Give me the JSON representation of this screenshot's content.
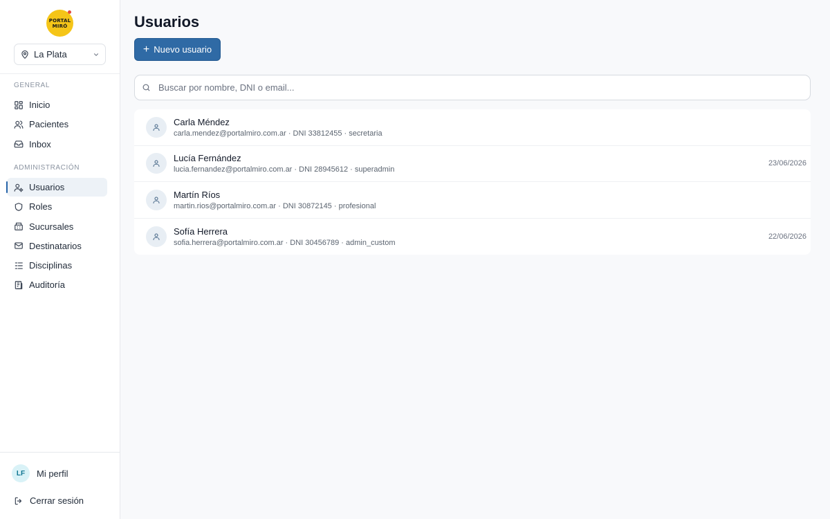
{
  "brand": {
    "logo_line1": "PORTAL",
    "logo_line2": "MIRÓ"
  },
  "branch": {
    "selected": "La Plata"
  },
  "nav": {
    "general_label": "GENERAL",
    "general_items": [
      {
        "label": "Inicio",
        "icon": "grid-icon"
      },
      {
        "label": "Pacientes",
        "icon": "users-icon"
      },
      {
        "label": "Inbox",
        "icon": "inbox-icon"
      }
    ],
    "admin_label": "ADMINISTRACIÓN",
    "admin_items": [
      {
        "label": "Usuarios",
        "icon": "user-gear-icon",
        "active": true
      },
      {
        "label": "Roles",
        "icon": "shield-icon"
      },
      {
        "label": "Sucursales",
        "icon": "building-icon"
      },
      {
        "label": "Destinatarios",
        "icon": "mail-icon"
      },
      {
        "label": "Disciplinas",
        "icon": "list-icon"
      },
      {
        "label": "Auditoría",
        "icon": "audit-icon"
      }
    ]
  },
  "footer": {
    "avatar_initials": "LF",
    "profile_label": "Mi perfil",
    "logout_label": "Cerrar sesión"
  },
  "main": {
    "title": "Usuarios",
    "new_button": "Nuevo usuario",
    "search_placeholder": "Buscar por nombre, DNI o email...",
    "users": [
      {
        "name": "Carla Méndez",
        "meta": "carla.mendez@portalmiro.com.ar · DNI 33812455 · secretaria",
        "date": ""
      },
      {
        "name": "Lucía Fernández",
        "meta": "lucia.fernandez@portalmiro.com.ar · DNI 28945612 · superadmin",
        "date": "23/06/2026"
      },
      {
        "name": "Martín Ríos",
        "meta": "martin.rios@portalmiro.com.ar · DNI 30872145 · profesional",
        "date": ""
      },
      {
        "name": "Sofía Herrera",
        "meta": "sofia.herrera@portalmiro.com.ar · DNI 30456789 · admin_custom",
        "date": "22/06/2026"
      }
    ]
  },
  "colors": {
    "accent": "#2f6aa5",
    "logo_yellow": "#f5c518",
    "avatar_bg": "#d9f2f7"
  }
}
